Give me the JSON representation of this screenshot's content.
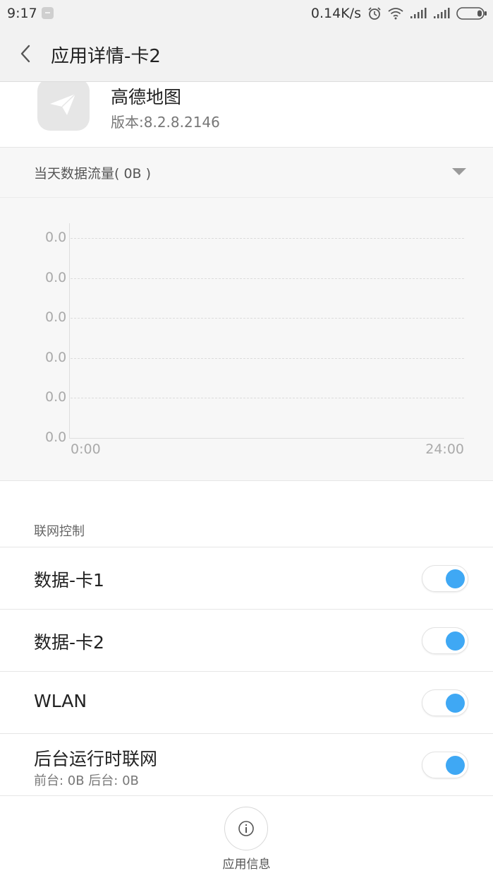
{
  "status_bar": {
    "time": "9:17",
    "net_speed": "0.14K/s",
    "icons": [
      "notification-icon",
      "alarm-icon",
      "wifi-icon",
      "signal-icon",
      "signal-icon",
      "battery-icon"
    ]
  },
  "header": {
    "title": "应用详情-卡2",
    "back_icon": "back-icon"
  },
  "app": {
    "name": "高德地图",
    "version": "版本:8.2.8.2146"
  },
  "usage": {
    "label": "当天数据流量( 0B )"
  },
  "chart_data": {
    "type": "line",
    "title": "",
    "xlabel": "",
    "ylabel": "",
    "x_ticks": [
      "0:00",
      "24:00"
    ],
    "y_ticks": [
      "0.0",
      "0.0",
      "0.0",
      "0.0",
      "0.0",
      "0.0"
    ],
    "series": [],
    "grid": true
  },
  "network_control": {
    "section_label": "联网控制",
    "items": [
      {
        "label": "数据-卡1",
        "sub": "",
        "on": true
      },
      {
        "label": "数据-卡2",
        "sub": "",
        "on": true
      },
      {
        "label": "WLAN",
        "sub": "",
        "on": true
      },
      {
        "label": "后台运行时联网",
        "sub": "前台: 0B  后台: 0B",
        "on": true
      }
    ]
  },
  "bottom": {
    "info_label": "应用信息"
  },
  "colors": {
    "accent": "#3fa8f4",
    "header_bg": "#f2f2f2"
  }
}
